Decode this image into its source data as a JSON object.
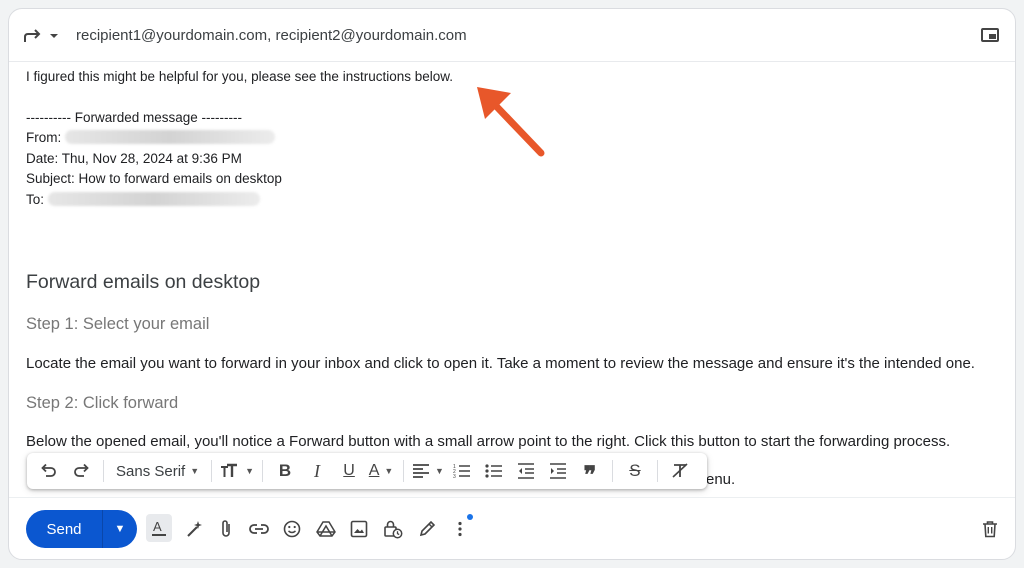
{
  "header": {
    "recipients": "recipient1@yourdomain.com, recipient2@yourdomain.com"
  },
  "message": {
    "intro": "I figured this might be helpful for you, please see the instructions below.",
    "forwarded_header": "---------- Forwarded message ---------",
    "from_label": "From:",
    "date_line": "Date: Thu, Nov 28, 2024 at 9:36 PM",
    "subject_line": "Subject: How to forward emails on desktop",
    "to_label": "To:"
  },
  "content": {
    "heading": "Forward emails on desktop",
    "step1_title": "Step 1: Select your email",
    "step1_text": "Locate the email you want to forward in your inbox and click to open it. Take a moment to review the message and ensure it's the intended one.",
    "step2_title": "Step 2: Click forward",
    "step2_text": "Below the opened email, you'll notice a Forward button with a small arrow point to the right. Click this button to start the forwarding process.",
    "partial_line": "enu."
  },
  "toolbar": {
    "font_family": "Sans Serif"
  },
  "bottom": {
    "send_label": "Send"
  },
  "colors": {
    "send_blue": "#0b57d0",
    "annotation_arrow": "#e8572a",
    "notify_dot": "#1a73e8"
  }
}
